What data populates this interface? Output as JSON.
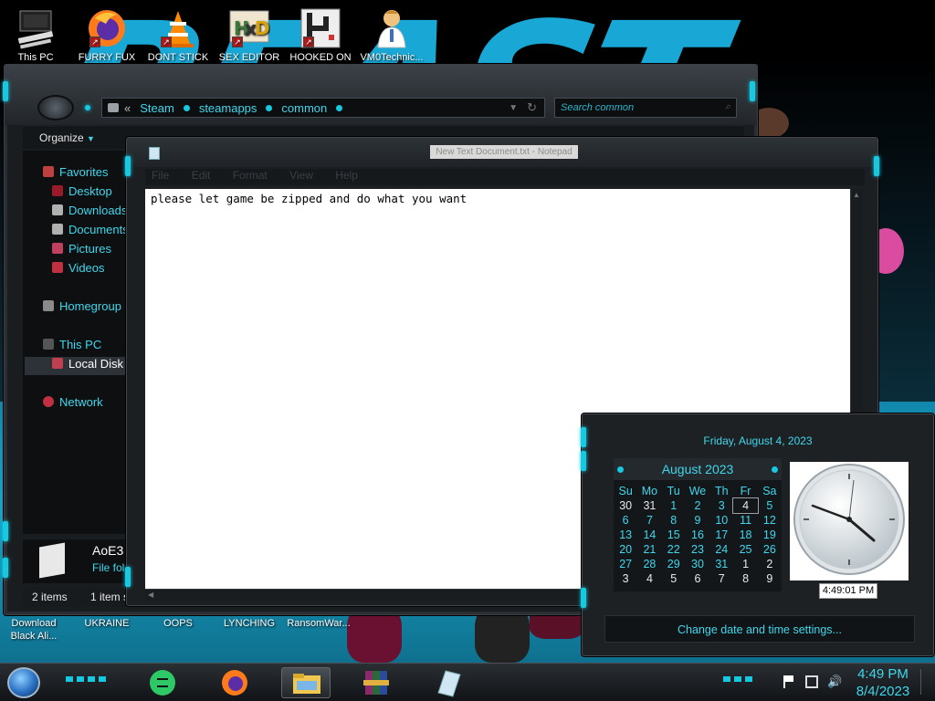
{
  "desktop": {
    "top_icons": [
      {
        "label": "This PC"
      },
      {
        "label": "FURRY FUX"
      },
      {
        "label": "DONT STICK"
      },
      {
        "label": "SEX EDITOR"
      },
      {
        "label": "HOOKED ON"
      },
      {
        "label": "VM0Technic..."
      }
    ],
    "bottom_labels": [
      {
        "label": "Download Black Ali..."
      },
      {
        "label": "UKRAINE"
      },
      {
        "label": "OOPS"
      },
      {
        "label": "LYNCHING"
      },
      {
        "label": "RansomWar..."
      }
    ]
  },
  "explorer": {
    "breadcrumb": [
      "Steam",
      "steamapps",
      "common"
    ],
    "search_placeholder": "Search common",
    "toolbar": {
      "organize": "Organize"
    },
    "nav": {
      "favorites": "Favorites",
      "desktop": "Desktop",
      "downloads": "Downloads",
      "documents": "Documents",
      "pictures": "Pictures",
      "videos": "Videos",
      "homegroup": "Homegroup",
      "this_pc": "This PC",
      "local_disk": "Local Disk",
      "network": "Network"
    },
    "details": {
      "name": "AoE3",
      "type": "File fol"
    },
    "status": {
      "items": "2 items",
      "selected": "1 item s"
    }
  },
  "notepad": {
    "title": "New Text Document.txt - Notepad",
    "menu": [
      "File",
      "Edit",
      "Format",
      "View",
      "Help"
    ],
    "content": "please let game be zipped and do what you want"
  },
  "calendar": {
    "long_date": "Friday, August 4, 2023",
    "month_label": "August 2023",
    "weekdays": [
      "Su",
      "Mo",
      "Tu",
      "We",
      "Th",
      "Fr",
      "Sa"
    ],
    "weeks": [
      [
        "30",
        "31",
        "1",
        "2",
        "3",
        "4",
        "5"
      ],
      [
        "6",
        "7",
        "8",
        "9",
        "10",
        "11",
        "12"
      ],
      [
        "13",
        "14",
        "15",
        "16",
        "17",
        "18",
        "19"
      ],
      [
        "20",
        "21",
        "22",
        "23",
        "24",
        "25",
        "26"
      ],
      [
        "27",
        "28",
        "29",
        "30",
        "31",
        "1",
        "2"
      ],
      [
        "3",
        "4",
        "5",
        "6",
        "7",
        "8",
        "9"
      ]
    ],
    "today": "4",
    "clock_time": "4:49:01 PM",
    "settings_link": "Change date and time settings..."
  },
  "taskbar": {
    "time": "4:49 PM",
    "date": "8/4/2023"
  },
  "colors": {
    "accent": "#3fd7ec",
    "accent_bright": "#16c8e0",
    "frame": "#1c1f22"
  }
}
